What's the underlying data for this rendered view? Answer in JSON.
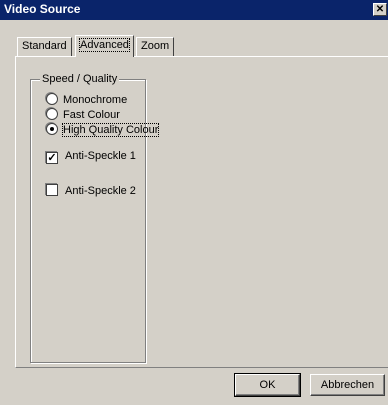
{
  "window": {
    "title": "Video Source",
    "close_glyph": "✕"
  },
  "tabs": [
    {
      "label": "Standard",
      "active": false
    },
    {
      "label": "Advanced",
      "active": true
    },
    {
      "label": "Zoom",
      "active": false
    }
  ],
  "group": {
    "title": "Speed / Quality",
    "radios": [
      {
        "label": "Monochrome",
        "selected": false
      },
      {
        "label": "Fast Colour",
        "selected": false
      },
      {
        "label": "High Quality Colour",
        "selected": true
      }
    ],
    "checkboxes": [
      {
        "label": "Anti-Speckle 1",
        "checked": true
      },
      {
        "label": "Anti-Speckle 2",
        "checked": false
      }
    ]
  },
  "buttons": {
    "ok": "OK",
    "cancel": "Abbrechen"
  }
}
